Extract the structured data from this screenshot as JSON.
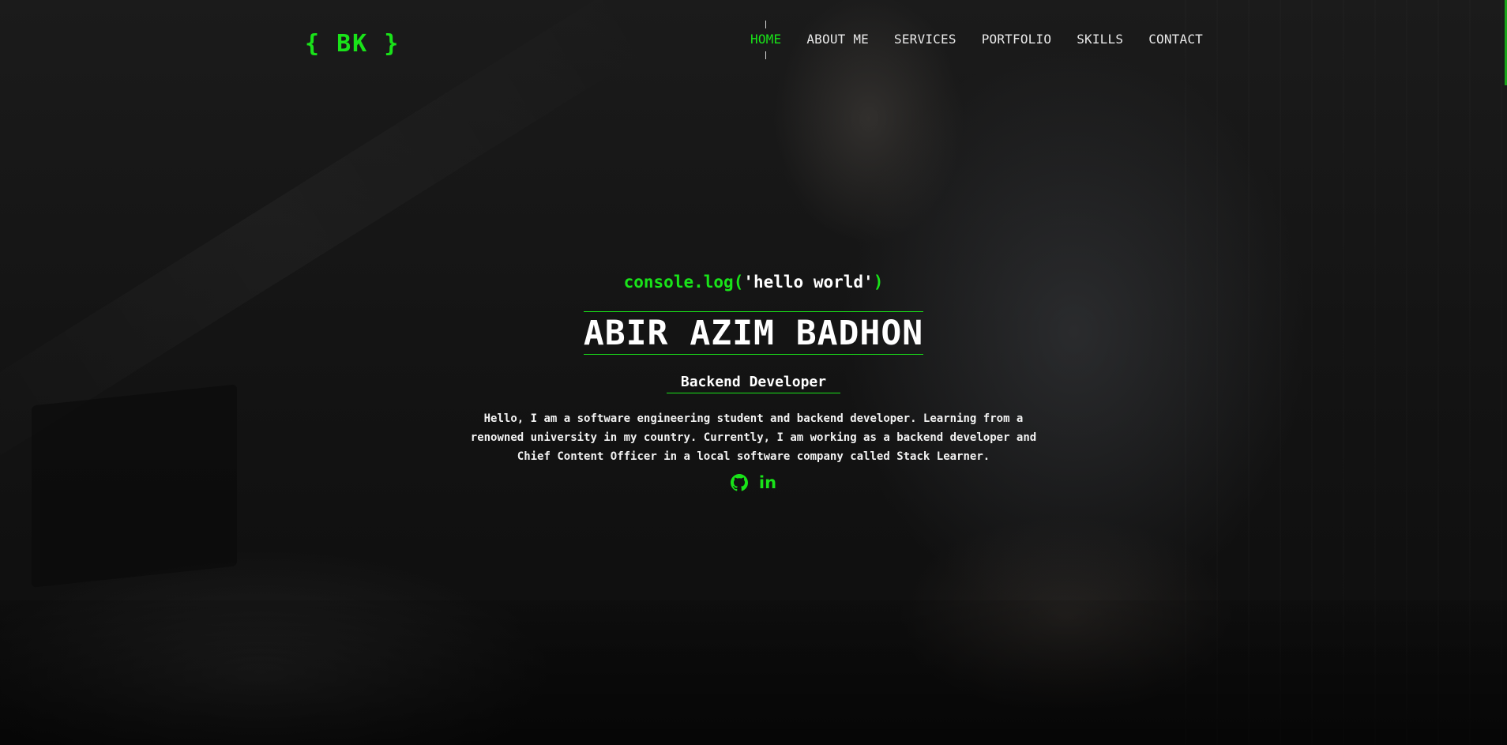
{
  "header": {
    "logo": "{ BK }",
    "nav": [
      {
        "label": "HOME",
        "active": true
      },
      {
        "label": "ABOUT ME",
        "active": false
      },
      {
        "label": "SERVICES",
        "active": false
      },
      {
        "label": "PORTFOLIO",
        "active": false
      },
      {
        "label": "SKILLS",
        "active": false
      },
      {
        "label": "CONTACT",
        "active": false
      }
    ]
  },
  "hero": {
    "code_fn": "console.log",
    "code_open": "(",
    "code_arg": "'hello world'",
    "code_close": ")",
    "name": "ABIR AZIM BADHON",
    "role": "Backend Developer",
    "bio": "Hello, I am a software engineering student and backend developer. Learning from a renowned university in my country. Currently, I am working as a backend developer and Chief Content Officer in a local software company called Stack Learner.",
    "socials": [
      {
        "icon": "github-icon"
      },
      {
        "icon": "linkedin-icon",
        "glyph": "in"
      }
    ]
  },
  "colors": {
    "accent": "#19e319",
    "text": "#ffffff",
    "background": "#121212"
  }
}
